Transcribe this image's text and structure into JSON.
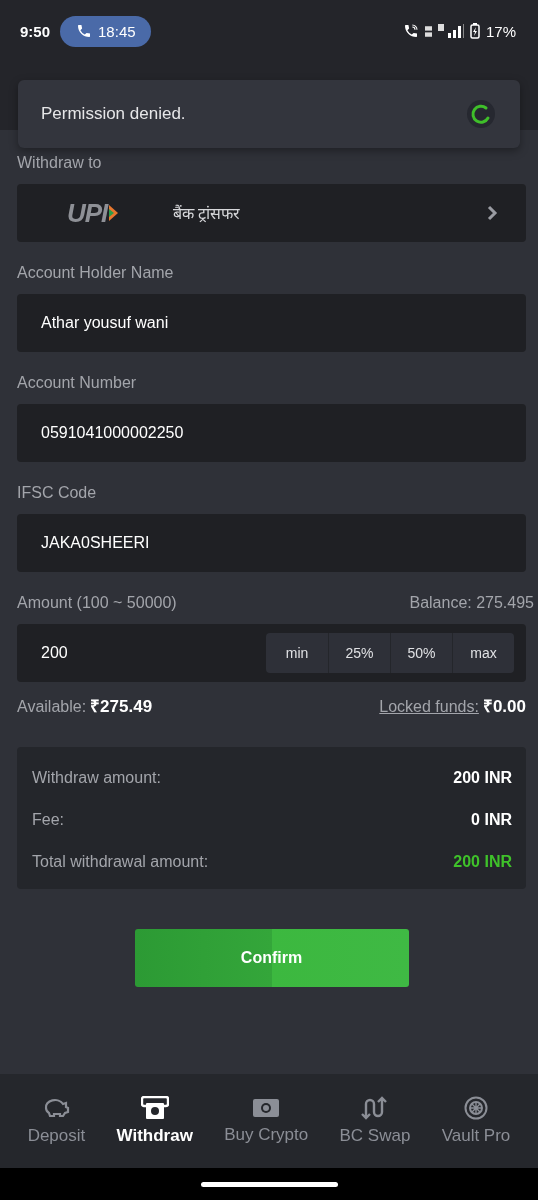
{
  "status_bar": {
    "time": "9:50",
    "call_timer": "18:45",
    "battery": "17%"
  },
  "toast": {
    "message": "Permission denied."
  },
  "withdraw_to": {
    "label": "Withdraw to",
    "logo_text": "UPI",
    "method": "बैंक ट्रांसफर"
  },
  "fields": [
    {
      "label": "Account Holder Name",
      "value": "Athar yousuf wani"
    },
    {
      "label": "Account Number",
      "value": "0591041000002250"
    },
    {
      "label": "IFSC Code",
      "value": "JAKA0SHEERI"
    }
  ],
  "amount": {
    "label": "Amount (100 ~ 50000)",
    "balance": "Balance: 275.495",
    "value": "200",
    "presets": [
      "min",
      "25%",
      "50%",
      "max"
    ],
    "available_label": "Available:",
    "available_value": "₹275.49",
    "locked_label": "Locked funds:",
    "locked_value": "₹0.00"
  },
  "summary": [
    {
      "label": "Withdraw amount:",
      "value": "200 INR",
      "highlight": false
    },
    {
      "label": "Fee:",
      "value": "0 INR",
      "highlight": false
    },
    {
      "label": "Total withdrawal amount:",
      "value": "200 INR",
      "highlight": true
    }
  ],
  "confirm_button": "Confirm",
  "nav": [
    {
      "label": "Deposit",
      "kind": "piggy",
      "selected": false
    },
    {
      "label": "Withdraw",
      "kind": "atm",
      "selected": true
    },
    {
      "label": "Buy Crypto",
      "kind": "cash",
      "selected": false
    },
    {
      "label": "BC Swap",
      "kind": "swap",
      "selected": false
    },
    {
      "label": "Vault Pro",
      "kind": "vault",
      "selected": false
    }
  ]
}
